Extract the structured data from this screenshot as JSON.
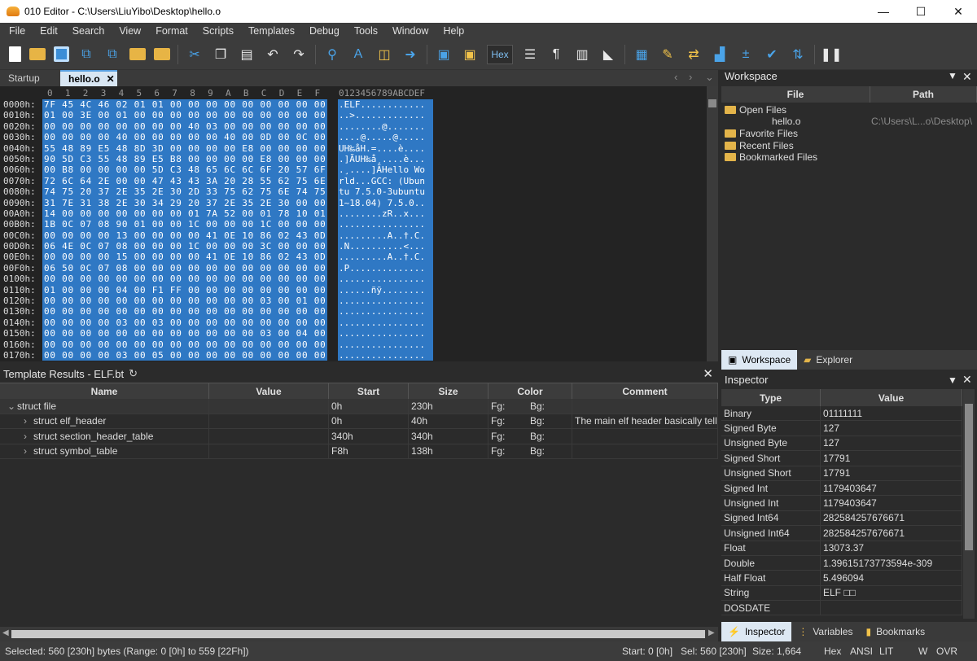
{
  "window": {
    "title": "010 Editor - C:\\Users\\LiuYibo\\Desktop\\hello.o",
    "minimize": "—",
    "maximize": "☐",
    "close": "✕"
  },
  "menu": [
    "File",
    "Edit",
    "Search",
    "View",
    "Format",
    "Scripts",
    "Templates",
    "Debug",
    "Tools",
    "Window",
    "Help"
  ],
  "toolbar": {
    "hex_label": "Hex"
  },
  "tabs": {
    "startup": "Startup",
    "file": "hello.o",
    "close": "✕"
  },
  "hex": {
    "col_header": [
      "0",
      "1",
      "2",
      "3",
      "4",
      "5",
      "6",
      "7",
      "8",
      "9",
      "A",
      "B",
      "C",
      "D",
      "E",
      "F"
    ],
    "ascii_header": "0123456789ABCDEF",
    "rows": [
      {
        "addr": "0000h:",
        "bytes": "7F 45 4C 46 02 01 01 00 00 00 00 00 00 00 00 00",
        "ascii": ".ELF............"
      },
      {
        "addr": "0010h:",
        "bytes": "01 00 3E 00 01 00 00 00 00 00 00 00 00 00 00 00",
        "ascii": "..>............."
      },
      {
        "addr": "0020h:",
        "bytes": "00 00 00 00 00 00 00 00 40 03 00 00 00 00 00 00",
        "ascii": "........@......."
      },
      {
        "addr": "0030h:",
        "bytes": "00 00 00 00 40 00 00 00 00 00 40 00 0D 00 0C 00",
        "ascii": "....@.....@....."
      },
      {
        "addr": "0040h:",
        "bytes": "55 48 89 E5 48 8D 3D 00 00 00 00 E8 00 00 00 00",
        "ascii": "UH‰åH.=....è...."
      },
      {
        "addr": "0050h:",
        "bytes": "90 5D C3 55 48 89 E5 B8 00 00 00 00 E8 00 00 00",
        "ascii": ".]ÃUH‰å¸....è..."
      },
      {
        "addr": "0060h:",
        "bytes": "00 B8 00 00 00 00 5D C3 48 65 6C 6C 6F 20 57 6F",
        "ascii": ".¸....]ÃHello Wo"
      },
      {
        "addr": "0070h:",
        "bytes": "72 6C 64 2E 00 00 47 43 43 3A 20 28 55 62 75 6E",
        "ascii": "rld...GCC: (Ubun"
      },
      {
        "addr": "0080h:",
        "bytes": "74 75 20 37 2E 35 2E 30 2D 33 75 62 75 6E 74 75",
        "ascii": "tu 7.5.0-3ubuntu"
      },
      {
        "addr": "0090h:",
        "bytes": "31 7E 31 38 2E 30 34 29 20 37 2E 35 2E 30 00 00",
        "ascii": "1~18.04) 7.5.0.."
      },
      {
        "addr": "00A0h:",
        "bytes": "14 00 00 00 00 00 00 00 01 7A 52 00 01 78 10 01",
        "ascii": "........zR..x..."
      },
      {
        "addr": "00B0h:",
        "bytes": "1B 0C 07 08 90 01 00 00 1C 00 00 00 1C 00 00 00",
        "ascii": "................"
      },
      {
        "addr": "00C0h:",
        "bytes": "00 00 00 00 13 00 00 00 00 41 0E 10 86 02 43 0D",
        "ascii": ".........A..†.C."
      },
      {
        "addr": "00D0h:",
        "bytes": "06 4E 0C 07 08 00 00 00 1C 00 00 00 3C 00 00 00",
        "ascii": ".N..........<..."
      },
      {
        "addr": "00E0h:",
        "bytes": "00 00 00 00 15 00 00 00 00 41 0E 10 86 02 43 0D",
        "ascii": ".........A..†.C."
      },
      {
        "addr": "00F0h:",
        "bytes": "06 50 0C 07 08 00 00 00 00 00 00 00 00 00 00 00",
        "ascii": ".P.............."
      },
      {
        "addr": "0100h:",
        "bytes": "00 00 00 00 00 00 00 00 00 00 00 00 00 00 00 00",
        "ascii": "................"
      },
      {
        "addr": "0110h:",
        "bytes": "01 00 00 00 04 00 F1 FF 00 00 00 00 00 00 00 00",
        "ascii": "......ñÿ........"
      },
      {
        "addr": "0120h:",
        "bytes": "00 00 00 00 00 00 00 00 00 00 00 00 03 00 01 00",
        "ascii": "................"
      },
      {
        "addr": "0130h:",
        "bytes": "00 00 00 00 00 00 00 00 00 00 00 00 00 00 00 00",
        "ascii": "................"
      },
      {
        "addr": "0140h:",
        "bytes": "00 00 00 00 03 00 03 00 00 00 00 00 00 00 00 00",
        "ascii": "................"
      },
      {
        "addr": "0150h:",
        "bytes": "00 00 00 00 00 00 00 00 00 00 00 00 03 00 04 00",
        "ascii": "................"
      },
      {
        "addr": "0160h:",
        "bytes": "00 00 00 00 00 00 00 00 00 00 00 00 00 00 00 00",
        "ascii": "................"
      },
      {
        "addr": "0170h:",
        "bytes": "00 00 00 00 03 00 05 00 00 00 00 00 00 00 00 00",
        "ascii": "................"
      }
    ]
  },
  "template": {
    "title": "Template Results - ELF.bt",
    "columns": {
      "name": "Name",
      "value": "Value",
      "start": "Start",
      "size": "Size",
      "color": "Color",
      "comment": "Comment"
    },
    "rows": [
      {
        "name": "struct file",
        "value": "",
        "start": "0h",
        "size": "230h",
        "fg": "Fg:",
        "bg": "Bg:",
        "comment": "",
        "expander": "⌄"
      },
      {
        "name": "struct elf_header",
        "value": "",
        "start": "0h",
        "size": "40h",
        "fg": "Fg:",
        "bg": "Bg:",
        "comment": "The main elf header basically tells",
        "expander": "›"
      },
      {
        "name": "struct section_header_table",
        "value": "",
        "start": "340h",
        "size": "340h",
        "fg": "Fg:",
        "bg": "Bg:",
        "comment": "",
        "expander": "›"
      },
      {
        "name": "struct symbol_table",
        "value": "",
        "start": "F8h",
        "size": "138h",
        "fg": "Fg:",
        "bg": "Bg:",
        "comment": "",
        "expander": "›"
      }
    ]
  },
  "workspace": {
    "title": "Workspace",
    "columns": {
      "file": "File",
      "path": "Path"
    },
    "items": {
      "open_files": "Open Files",
      "hello": "hello.o",
      "hello_path": "C:\\Users\\L...o\\Desktop\\",
      "favorites": "Favorite Files",
      "recent": "Recent Files",
      "bookmarked": "Bookmarked Files"
    },
    "tabs": {
      "workspace": "Workspace",
      "explorer": "Explorer"
    }
  },
  "inspector": {
    "title": "Inspector",
    "columns": {
      "type": "Type",
      "value": "Value"
    },
    "rows": [
      {
        "type": "Binary",
        "value": "01111111"
      },
      {
        "type": "Signed Byte",
        "value": "127"
      },
      {
        "type": "Unsigned Byte",
        "value": "127"
      },
      {
        "type": "Signed Short",
        "value": "17791"
      },
      {
        "type": "Unsigned Short",
        "value": "17791"
      },
      {
        "type": "Signed Int",
        "value": "1179403647"
      },
      {
        "type": "Unsigned Int",
        "value": "1179403647"
      },
      {
        "type": "Signed Int64",
        "value": "282584257676671"
      },
      {
        "type": "Unsigned Int64",
        "value": "282584257676671"
      },
      {
        "type": "Float",
        "value": "13073.37"
      },
      {
        "type": "Double",
        "value": "1.39615173773594e-309"
      },
      {
        "type": "Half Float",
        "value": "5.496094"
      },
      {
        "type": "String",
        "value": "ELF □□"
      },
      {
        "type": "DOSDATE",
        "value": ""
      }
    ],
    "tabs": {
      "inspector": "Inspector",
      "variables": "Variables",
      "bookmarks": "Bookmarks"
    }
  },
  "status": {
    "selected": "Selected: 560 [230h] bytes (Range: 0 [0h] to 559 [22Fh])",
    "start": "Start: 0 [0h]",
    "sel": "Sel: 560 [230h]",
    "size": "Size: 1,664",
    "hex": "Hex",
    "ansi": "ANSI",
    "lit": "LIT",
    "w": "W",
    "ovr": "OVR"
  }
}
